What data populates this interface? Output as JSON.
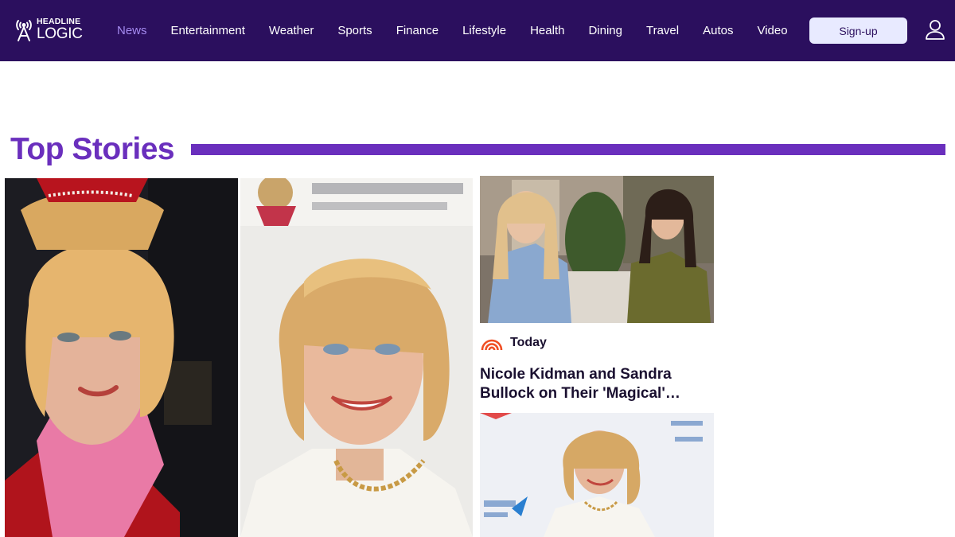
{
  "header": {
    "logo": {
      "line1": "HEADLINE",
      "line2": "LOGIC"
    },
    "nav": [
      {
        "label": "News",
        "active": true
      },
      {
        "label": "Entertainment"
      },
      {
        "label": "Weather"
      },
      {
        "label": "Sports"
      },
      {
        "label": "Finance"
      },
      {
        "label": "Lifestyle"
      },
      {
        "label": "Health"
      },
      {
        "label": "Dining"
      },
      {
        "label": "Travel"
      },
      {
        "label": "Autos"
      },
      {
        "label": "Video"
      }
    ],
    "signup_label": "Sign-up",
    "icons": {
      "user": "user-icon",
      "logo": "radio-tower-icon"
    }
  },
  "top_stories": {
    "title": "Top Stories",
    "accent_color": "#6a2fbd",
    "secondary_card": {
      "source": "Today",
      "source_icon": "rainbow-logo-icon",
      "headline": "Nicole Kidman and Sandra Bullock on Their 'Magical'…"
    }
  },
  "colors": {
    "header_bg": "#2b0f5e",
    "nav_active": "#a58bf0",
    "signup_bg": "#e8eaff",
    "accent": "#6a2fbd"
  }
}
